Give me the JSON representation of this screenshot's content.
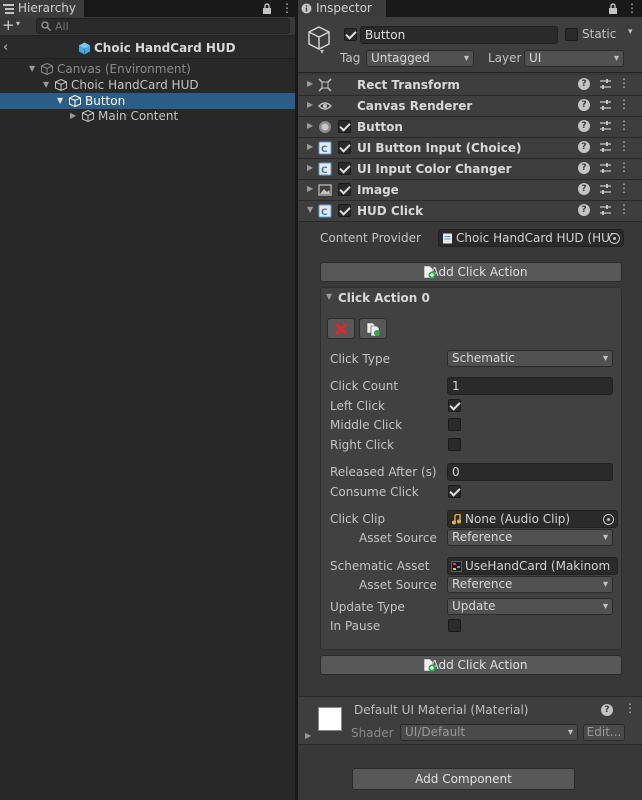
{
  "hierarchy": {
    "tab_label": "Hierarchy",
    "search_placeholder": "All",
    "scene_title": "Choic HandCard HUD",
    "tree": [
      {
        "label": "Canvas (Environment)"
      },
      {
        "label": "Choic HandCard HUD"
      },
      {
        "label": "Button"
      },
      {
        "label": "Main Content"
      }
    ]
  },
  "inspector": {
    "tab_label": "Inspector",
    "object_name": "Button",
    "static_label": "Static",
    "tag_label": "Tag",
    "tag_value": "Untagged",
    "layer_label": "Layer",
    "layer_value": "UI",
    "components": [
      {
        "name": "Rect Transform"
      },
      {
        "name": "Canvas Renderer"
      },
      {
        "name": "Button"
      },
      {
        "name": "UI Button Input (Choice)"
      },
      {
        "name": "UI Input Color Changer"
      },
      {
        "name": "Image"
      },
      {
        "name": "HUD Click"
      }
    ],
    "hud_click": {
      "content_provider_label": "Content Provider",
      "content_provider_value": "Choic HandCard HUD (HUD",
      "add_click_action": "Add Click Action",
      "action_title": "Click Action 0",
      "fields": {
        "click_type_label": "Click Type",
        "click_type_value": "Schematic",
        "click_count_label": "Click Count",
        "click_count_value": "1",
        "left_click_label": "Left Click",
        "middle_click_label": "Middle Click",
        "right_click_label": "Right Click",
        "released_after_label": "Released After (s)",
        "released_after_value": "0",
        "consume_click_label": "Consume Click",
        "click_clip_label": "Click Clip",
        "click_clip_value": "None (Audio Clip)",
        "asset_source_label": "Asset Source",
        "asset_source_value": "Reference",
        "schematic_asset_label": "Schematic Asset",
        "schematic_asset_value": "UseHandCard (Makinom",
        "asset_source2_label": "Asset Source",
        "asset_source2_value": "Reference",
        "update_type_label": "Update Type",
        "update_type_value": "Update",
        "in_pause_label": "In Pause"
      },
      "add_click_action_bottom": "Add Click Action"
    },
    "material": {
      "name": "Default UI Material (Material)",
      "shader_label": "Shader",
      "shader_value": "UI/Default",
      "edit_label": "Edit..."
    },
    "add_component": "Add Component"
  }
}
